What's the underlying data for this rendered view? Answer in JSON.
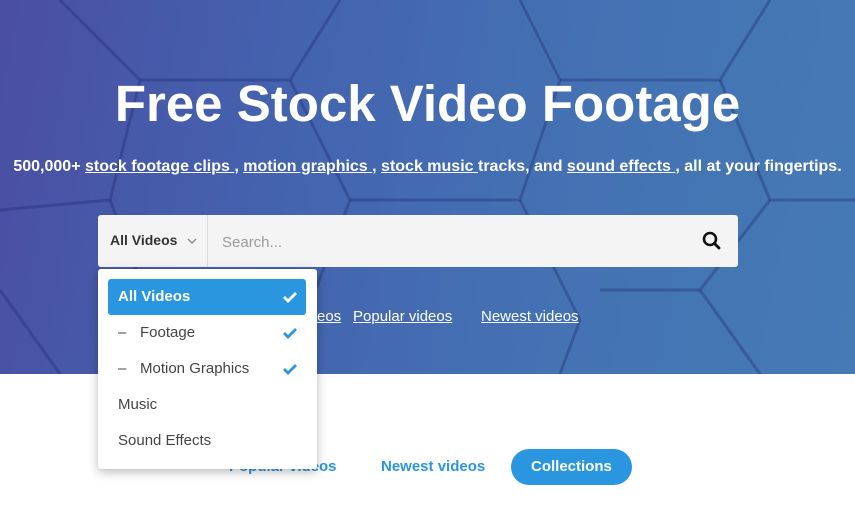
{
  "hero": {
    "title": "Free Stock Video Footage",
    "subtitle": {
      "prefix": "500,000+ ",
      "link1": "stock footage clips ",
      "sep1": ", ",
      "link2": "motion graphics ",
      "sep2": ", ",
      "link3": "stock music ",
      "mid": "tracks, and ",
      "link4": "sound effects ",
      "suffix": ", all at your fingertips."
    },
    "links": [
      "Trending videos",
      "Popular videos",
      "Newest videos"
    ]
  },
  "search": {
    "category_label": "All Videos",
    "placeholder": "Search...",
    "value": "",
    "search_icon": "search-icon"
  },
  "dropdown": {
    "items": [
      {
        "label": "All Videos",
        "prefix": "",
        "checked": true,
        "selected": true
      },
      {
        "label": "Footage",
        "prefix": "–",
        "checked": true,
        "selected": false
      },
      {
        "label": "Motion Graphics",
        "prefix": "–",
        "checked": true,
        "selected": false
      },
      {
        "label": "Music",
        "prefix": "",
        "checked": false,
        "selected": false
      },
      {
        "label": "Sound Effects",
        "prefix": "",
        "checked": false,
        "selected": false
      }
    ]
  },
  "tabs": {
    "items": [
      "Popular videos",
      "Newest videos",
      "Collections"
    ],
    "active": "Collections"
  },
  "colors": {
    "accent": "#2a96df",
    "hero_start": "#4b4ea3",
    "hero_end": "#457ab5"
  }
}
